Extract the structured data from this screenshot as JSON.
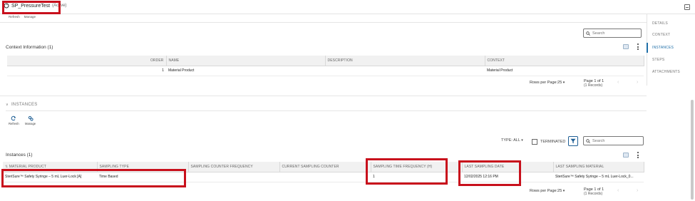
{
  "header": {
    "title": "SP_PressureTest",
    "state": "(Active)"
  },
  "top_toolbar": {
    "refresh": "Refresh",
    "manage": "Manage"
  },
  "sidebar": {
    "items": [
      "DETAILS",
      "CONTEXT",
      "INSTANCES",
      "STEPS",
      "ATTACHMENTS"
    ],
    "active": "INSTANCES"
  },
  "context": {
    "search_placeholder": "Search",
    "title": "Context Information (1)",
    "columns": [
      "ORDER",
      "NAME",
      "DESCRIPTION",
      "CONTEXT"
    ],
    "rows": [
      {
        "order": "1",
        "name": "Material Product",
        "description": "",
        "context": "Material Product"
      }
    ],
    "rows_per_page_label": "Rows per Page:",
    "rows_per_page": "25",
    "page": "Page 1 of 1",
    "records": "(1 Records)"
  },
  "instances": {
    "heading": "INSTANCES",
    "refresh": "Refresh",
    "manage": "Manage",
    "type_label": "TYPE:",
    "type_value": "ALL",
    "terminated_label": "TERMINATED",
    "search_placeholder": "Search",
    "title": "Instances (1)",
    "columns": [
      "MATERIAL PRODUCT",
      "SAMPLING TYPE",
      "SAMPLING COUNTER FREQUENCY",
      "CURRENT SAMPLING COUNTER",
      "SAMPLING TIME FREQUENCY (H)",
      "LAST SAMPLING DATE",
      "LAST SAMPLING MATERIAL"
    ],
    "rows": [
      {
        "material_product": "SteriSure™ Safety Syringe – 5 mL Luer-Lock [A]",
        "sampling_type": "Time Based",
        "counter_frequency": "",
        "current_counter": "",
        "time_frequency": "1",
        "last_date": "12/02/2025 12:16 PM",
        "last_material": "SteriSure™ Safety Syringe – 5 mL Luer-Lock_0..."
      }
    ],
    "rows_per_page_label": "Rows per Page:",
    "rows_per_page": "25",
    "page": "Page 1 of 1",
    "records": "(1 Records)"
  },
  "colors": {
    "accent": "#1f6fa8",
    "highlight": "#c8101c"
  }
}
